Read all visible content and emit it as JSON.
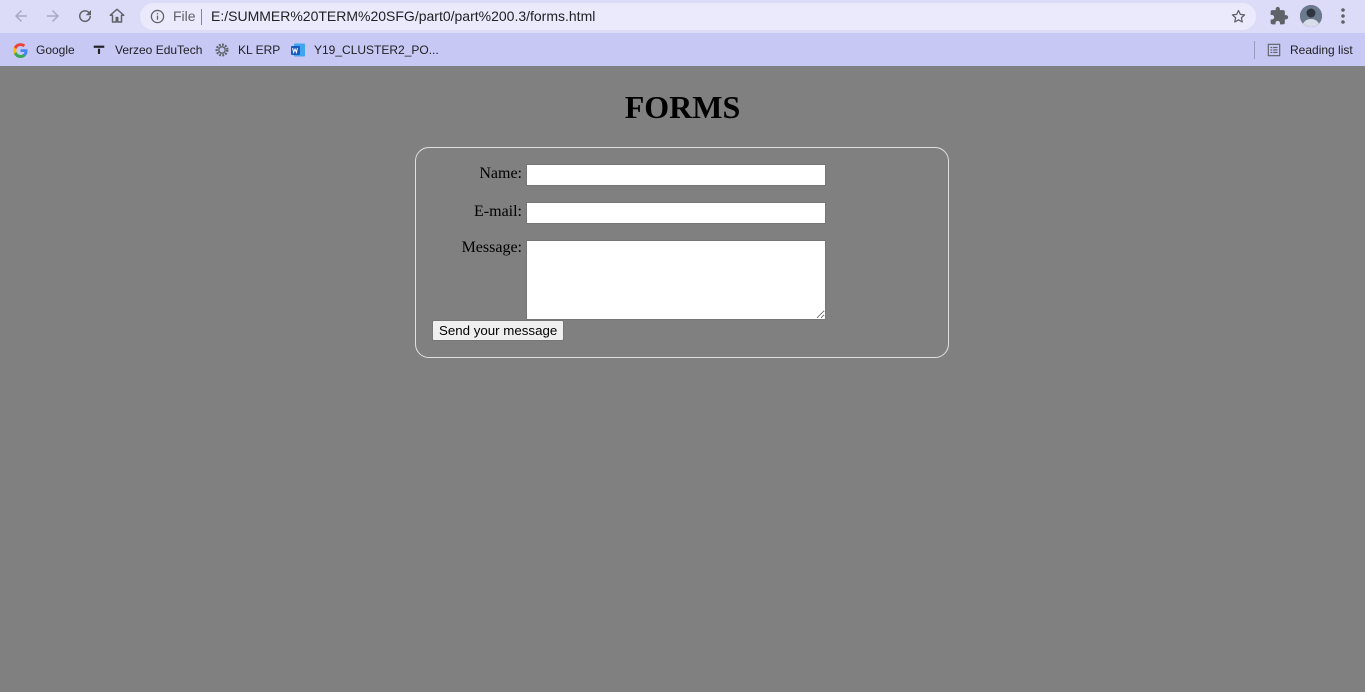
{
  "browser": {
    "omnibox": {
      "scheme_label": "File",
      "url": "E:/SUMMER%20TERM%20SFG/part0/part%200.3/forms.html"
    },
    "nav": {
      "back": "back-icon",
      "forward": "forward-icon",
      "reload": "reload-icon",
      "home": "home-icon"
    },
    "bookmarks": [
      {
        "label": "Google",
        "icon": "google-icon"
      },
      {
        "label": "Verzeo EduTech",
        "icon": "verzeo-icon"
      },
      {
        "label": "KL ERP",
        "icon": "gear-icon"
      },
      {
        "label": "Y19_CLUSTER2_PO...",
        "icon": "word-doc-icon"
      }
    ],
    "reading_list": "Reading list"
  },
  "page": {
    "title": "FORMS",
    "form": {
      "name_label": "Name:",
      "name_value": "",
      "email_label": "E-mail:",
      "email_value": "",
      "message_label": "Message:",
      "message_value": "",
      "submit_label": "Send your message"
    },
    "colors": {
      "background": "#808080",
      "border": "#e0e0e0"
    }
  }
}
